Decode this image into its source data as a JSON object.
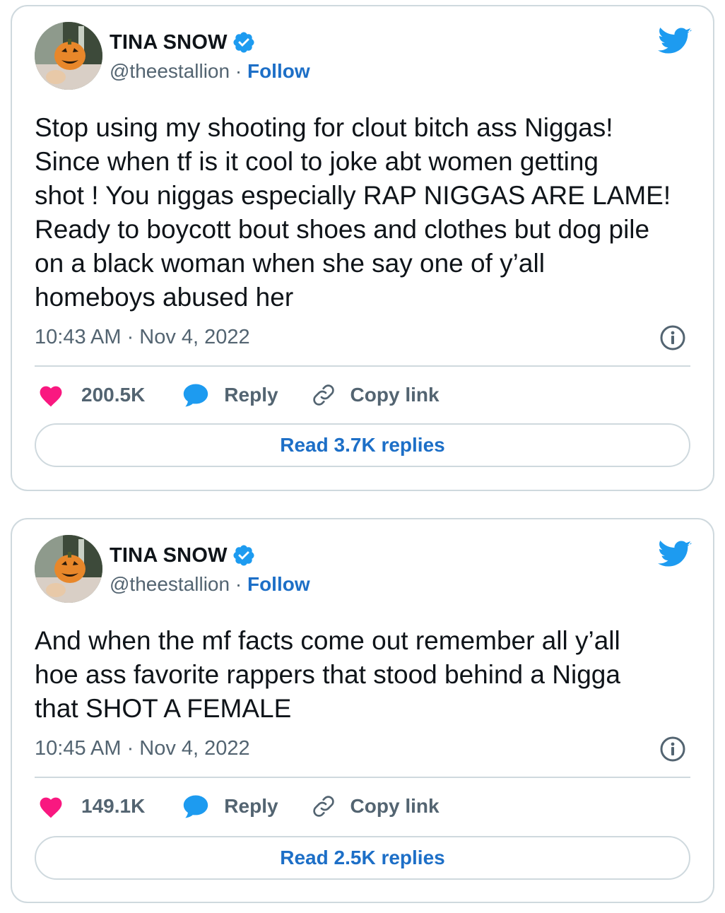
{
  "colors": {
    "accent": "#1d9bf0",
    "link": "#1d6fc7",
    "like": "#f91880",
    "muted": "#536471",
    "border": "#cfd9de"
  },
  "tweets": [
    {
      "author": "TINA SNOW",
      "handle": "@theestallion",
      "separator": " · ",
      "follow": "Follow",
      "text": "Stop using my shooting for clout bitch ass Niggas!\nSince when tf is it cool to joke abt women getting\nshot ! You niggas especially RAP NIGGAS ARE LAME!\nReady to boycott bout shoes and clothes but dog pile\non a black woman when she say one of y’all\nhomeboys abused her",
      "timestamp": "10:43 AM · Nov 4, 2022",
      "likes": "200.5K",
      "reply_label": "Reply",
      "copy_label": "Copy link",
      "read_replies": "Read 3.7K replies"
    },
    {
      "author": "TINA SNOW",
      "handle": "@theestallion",
      "separator": " · ",
      "follow": "Follow",
      "text": "And when the mf facts come out remember all y’all\nhoe ass favorite rappers that stood behind a Nigga\nthat SHOT A FEMALE",
      "timestamp": "10:45 AM · Nov 4, 2022",
      "likes": "149.1K",
      "reply_label": "Reply",
      "copy_label": "Copy link",
      "read_replies": "Read 2.5K replies"
    }
  ],
  "icons": [
    "verified-badge-icon",
    "twitter-bird-icon",
    "info-icon",
    "heart-icon",
    "reply-bubble-icon",
    "link-icon"
  ]
}
